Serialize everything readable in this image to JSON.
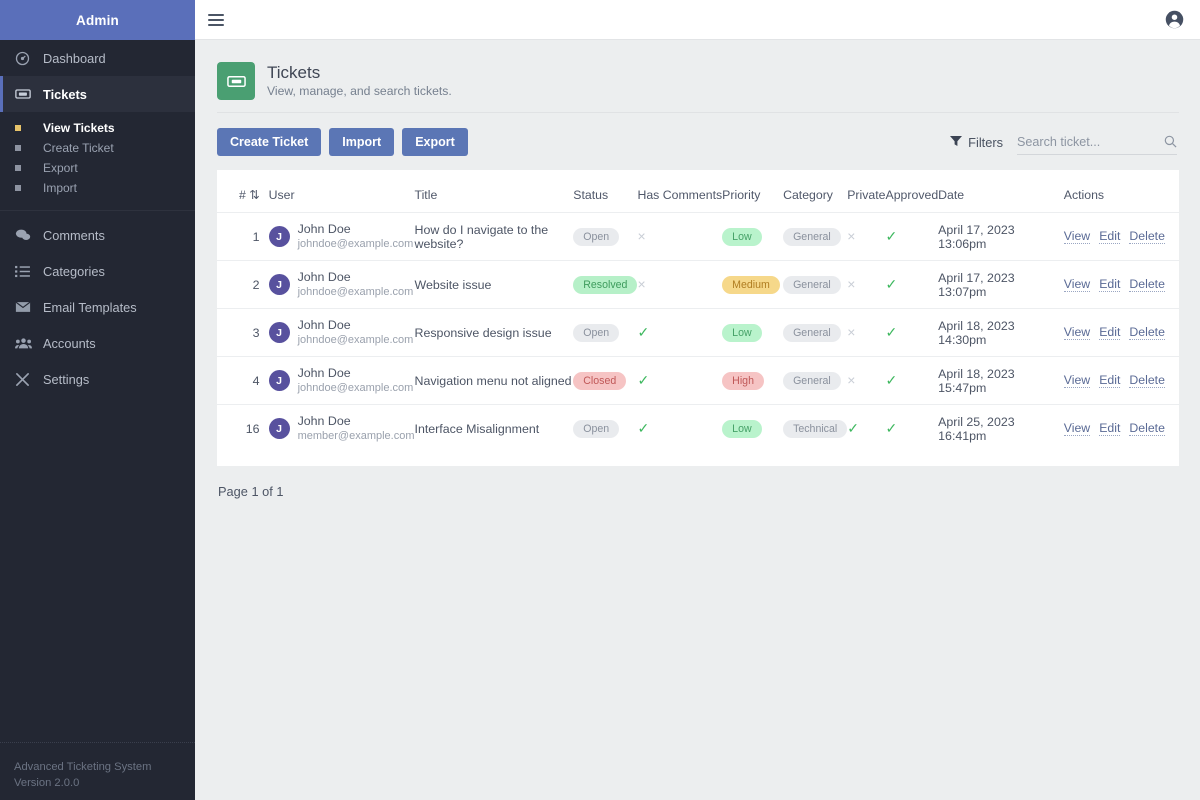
{
  "sidebar": {
    "brand": "Admin",
    "items": [
      {
        "label": "Dashboard",
        "icon": "dashboard-icon",
        "active": false
      },
      {
        "label": "Tickets",
        "icon": "ticket-icon",
        "active": true
      },
      {
        "label": "Comments",
        "icon": "comments-icon",
        "active": false
      },
      {
        "label": "Categories",
        "icon": "list-icon",
        "active": false
      },
      {
        "label": "Email Templates",
        "icon": "envelope-icon",
        "active": false
      },
      {
        "label": "Accounts",
        "icon": "users-icon",
        "active": false
      },
      {
        "label": "Settings",
        "icon": "tools-icon",
        "active": false
      }
    ],
    "subnav": [
      {
        "label": "View Tickets",
        "active": true
      },
      {
        "label": "Create Ticket",
        "active": false
      },
      {
        "label": "Export",
        "active": false
      },
      {
        "label": "Import",
        "active": false
      }
    ],
    "footer": {
      "app_name": "Advanced Ticketing System",
      "version": "Version 2.0.0"
    }
  },
  "topbar": {
    "menu_icon": "hamburger-icon",
    "account_icon": "user-circle-icon"
  },
  "page": {
    "icon": "ticket-icon",
    "title": "Tickets",
    "subtitle": "View, manage, and search tickets."
  },
  "toolbar": {
    "create_label": "Create Ticket",
    "import_label": "Import",
    "export_label": "Export",
    "filters_label": "Filters",
    "filters_icon": "funnel-icon",
    "search_placeholder": "Search ticket...",
    "search_value": "",
    "search_icon": "search-icon"
  },
  "table": {
    "headers": {
      "id": "#",
      "sort_icon": "sort-arrow-icon",
      "user": "User",
      "title": "Title",
      "status": "Status",
      "has_comments": "Has Comments",
      "priority": "Priority",
      "category": "Category",
      "private": "Private",
      "approved": "Approved",
      "date": "Date",
      "actions": "Actions"
    },
    "rows": [
      {
        "id": "1",
        "avatar": "J",
        "name": "John Doe",
        "email": "johndoe@example.com",
        "title": "How do I navigate to the website?",
        "status": "Open",
        "status_style": "b-grey",
        "has_comments": "×",
        "has_comments_state": "no",
        "priority": "Low",
        "priority_style": "b-lgreen",
        "category": "General",
        "category_style": "b-grey",
        "private": "×",
        "private_state": "no",
        "approved": "✓",
        "approved_state": "yes",
        "date": "April 17, 2023 13:06pm"
      },
      {
        "id": "2",
        "avatar": "J",
        "name": "John Doe",
        "email": "johndoe@example.com",
        "title": "Website issue",
        "status": "Resolved",
        "status_style": "b-green",
        "has_comments": "×",
        "has_comments_state": "no",
        "priority": "Medium",
        "priority_style": "b-amber",
        "category": "General",
        "category_style": "b-grey",
        "private": "×",
        "private_state": "no",
        "approved": "✓",
        "approved_state": "yes",
        "date": "April 17, 2023 13:07pm"
      },
      {
        "id": "3",
        "avatar": "J",
        "name": "John Doe",
        "email": "johndoe@example.com",
        "title": "Responsive design issue",
        "status": "Open",
        "status_style": "b-grey",
        "has_comments": "✓",
        "has_comments_state": "yes",
        "priority": "Low",
        "priority_style": "b-lgreen",
        "category": "General",
        "category_style": "b-grey",
        "private": "×",
        "private_state": "no",
        "approved": "✓",
        "approved_state": "yes",
        "date": "April 18, 2023 14:30pm"
      },
      {
        "id": "4",
        "avatar": "J",
        "name": "John Doe",
        "email": "johndoe@example.com",
        "title": "Navigation menu not aligned",
        "status": "Closed",
        "status_style": "b-red",
        "has_comments": "✓",
        "has_comments_state": "yes",
        "priority": "High",
        "priority_style": "b-red",
        "category": "General",
        "category_style": "b-grey",
        "private": "×",
        "private_state": "no",
        "approved": "✓",
        "approved_state": "yes",
        "date": "April 18, 2023 15:47pm"
      },
      {
        "id": "16",
        "avatar": "J",
        "name": "John Doe",
        "email": "member@example.com",
        "title": "Interface Misalignment",
        "status": "Open",
        "status_style": "b-grey",
        "has_comments": "✓",
        "has_comments_state": "yes",
        "priority": "Low",
        "priority_style": "b-lgreen",
        "category": "Technical",
        "category_style": "b-grey",
        "private": "✓",
        "private_state": "yes",
        "approved": "✓",
        "approved_state": "yes",
        "date": "April 25, 2023 16:41pm"
      }
    ],
    "actions": {
      "view": "View",
      "edit": "Edit",
      "delete": "Delete"
    }
  },
  "pagination": {
    "label": "Page 1 of 1"
  },
  "colors": {
    "brand": "#5a6fba",
    "sidebar_bg": "#232733",
    "page_icon_bg": "#4a9f72",
    "button_bg": "#5b76b5",
    "check_green": "#3fb860",
    "cross_grey": "#c9ced6"
  }
}
